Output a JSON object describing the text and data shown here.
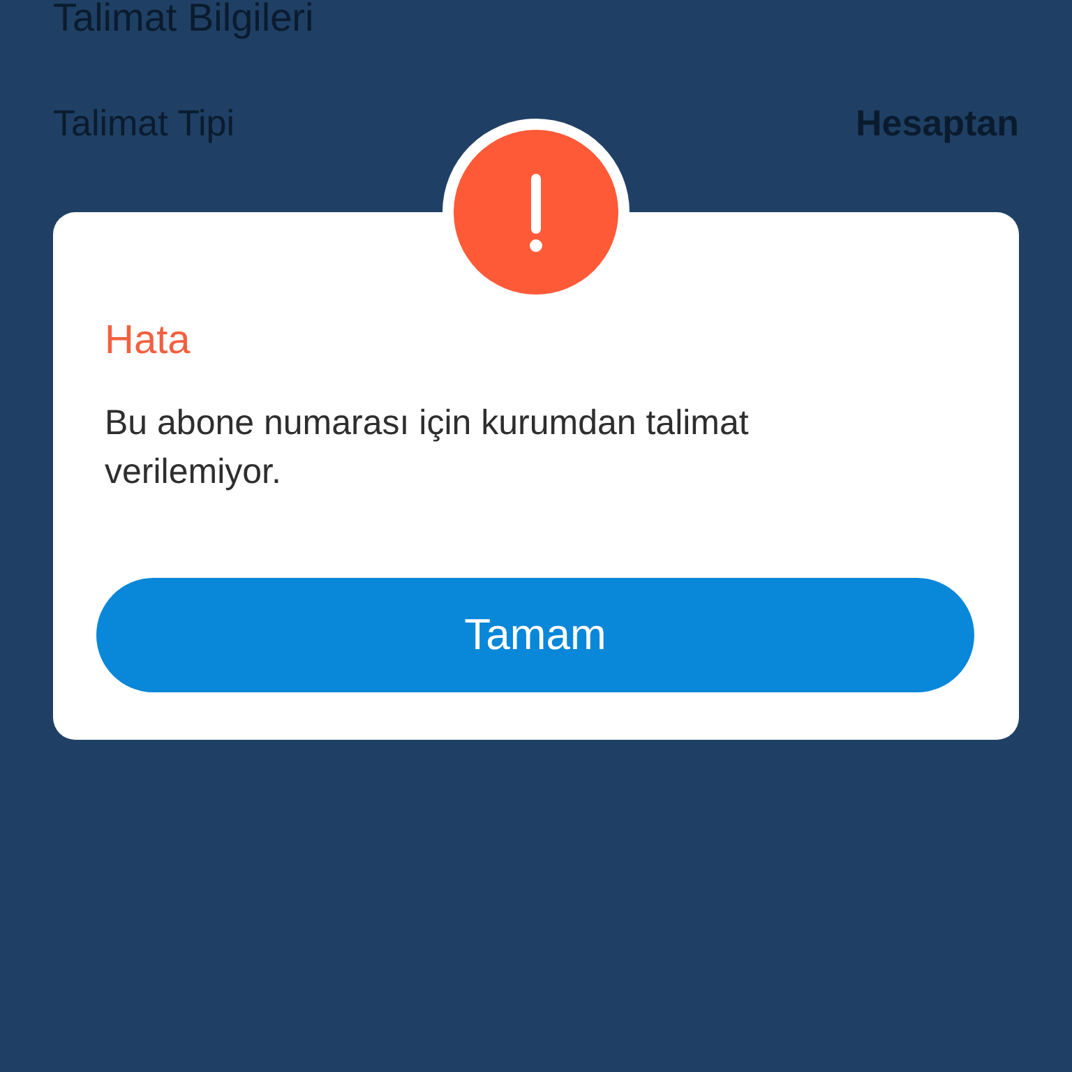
{
  "background_page": {
    "section_title": "Talimat Bilgileri",
    "rows": [
      {
        "label": "Talimat Tipi",
        "value": "Hesaptan"
      }
    ]
  },
  "dialog": {
    "title": "Hata",
    "message": "Bu abone numarası için kurumdan talimat verilemiyor.",
    "buttons": [
      "Tamam"
    ]
  }
}
